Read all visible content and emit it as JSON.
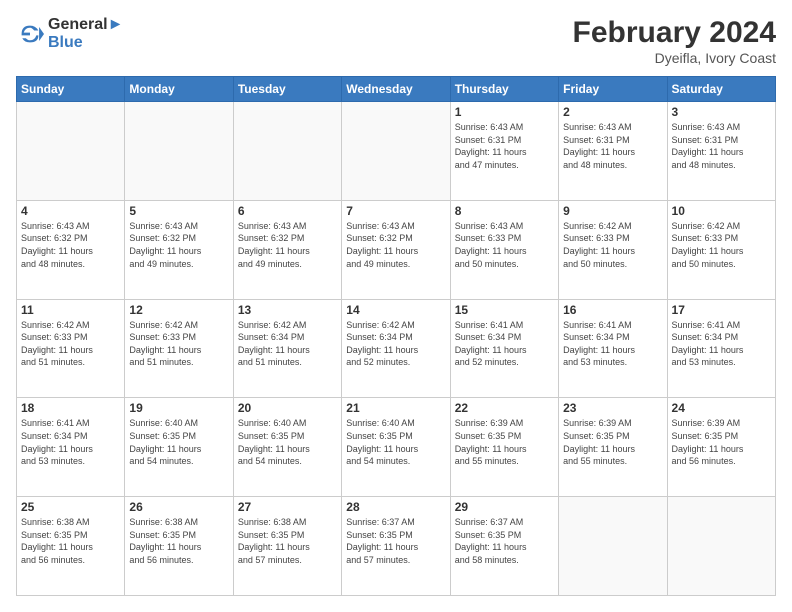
{
  "header": {
    "logo_line1": "General",
    "logo_line2": "Blue",
    "month_title": "February 2024",
    "subtitle": "Dyeifla, Ivory Coast"
  },
  "weekdays": [
    "Sunday",
    "Monday",
    "Tuesday",
    "Wednesday",
    "Thursday",
    "Friday",
    "Saturday"
  ],
  "weeks": [
    [
      {
        "num": "",
        "info": ""
      },
      {
        "num": "",
        "info": ""
      },
      {
        "num": "",
        "info": ""
      },
      {
        "num": "",
        "info": ""
      },
      {
        "num": "1",
        "info": "Sunrise: 6:43 AM\nSunset: 6:31 PM\nDaylight: 11 hours\nand 47 minutes."
      },
      {
        "num": "2",
        "info": "Sunrise: 6:43 AM\nSunset: 6:31 PM\nDaylight: 11 hours\nand 48 minutes."
      },
      {
        "num": "3",
        "info": "Sunrise: 6:43 AM\nSunset: 6:31 PM\nDaylight: 11 hours\nand 48 minutes."
      }
    ],
    [
      {
        "num": "4",
        "info": "Sunrise: 6:43 AM\nSunset: 6:32 PM\nDaylight: 11 hours\nand 48 minutes."
      },
      {
        "num": "5",
        "info": "Sunrise: 6:43 AM\nSunset: 6:32 PM\nDaylight: 11 hours\nand 49 minutes."
      },
      {
        "num": "6",
        "info": "Sunrise: 6:43 AM\nSunset: 6:32 PM\nDaylight: 11 hours\nand 49 minutes."
      },
      {
        "num": "7",
        "info": "Sunrise: 6:43 AM\nSunset: 6:32 PM\nDaylight: 11 hours\nand 49 minutes."
      },
      {
        "num": "8",
        "info": "Sunrise: 6:43 AM\nSunset: 6:33 PM\nDaylight: 11 hours\nand 50 minutes."
      },
      {
        "num": "9",
        "info": "Sunrise: 6:42 AM\nSunset: 6:33 PM\nDaylight: 11 hours\nand 50 minutes."
      },
      {
        "num": "10",
        "info": "Sunrise: 6:42 AM\nSunset: 6:33 PM\nDaylight: 11 hours\nand 50 minutes."
      }
    ],
    [
      {
        "num": "11",
        "info": "Sunrise: 6:42 AM\nSunset: 6:33 PM\nDaylight: 11 hours\nand 51 minutes."
      },
      {
        "num": "12",
        "info": "Sunrise: 6:42 AM\nSunset: 6:33 PM\nDaylight: 11 hours\nand 51 minutes."
      },
      {
        "num": "13",
        "info": "Sunrise: 6:42 AM\nSunset: 6:34 PM\nDaylight: 11 hours\nand 51 minutes."
      },
      {
        "num": "14",
        "info": "Sunrise: 6:42 AM\nSunset: 6:34 PM\nDaylight: 11 hours\nand 52 minutes."
      },
      {
        "num": "15",
        "info": "Sunrise: 6:41 AM\nSunset: 6:34 PM\nDaylight: 11 hours\nand 52 minutes."
      },
      {
        "num": "16",
        "info": "Sunrise: 6:41 AM\nSunset: 6:34 PM\nDaylight: 11 hours\nand 53 minutes."
      },
      {
        "num": "17",
        "info": "Sunrise: 6:41 AM\nSunset: 6:34 PM\nDaylight: 11 hours\nand 53 minutes."
      }
    ],
    [
      {
        "num": "18",
        "info": "Sunrise: 6:41 AM\nSunset: 6:34 PM\nDaylight: 11 hours\nand 53 minutes."
      },
      {
        "num": "19",
        "info": "Sunrise: 6:40 AM\nSunset: 6:35 PM\nDaylight: 11 hours\nand 54 minutes."
      },
      {
        "num": "20",
        "info": "Sunrise: 6:40 AM\nSunset: 6:35 PM\nDaylight: 11 hours\nand 54 minutes."
      },
      {
        "num": "21",
        "info": "Sunrise: 6:40 AM\nSunset: 6:35 PM\nDaylight: 11 hours\nand 54 minutes."
      },
      {
        "num": "22",
        "info": "Sunrise: 6:39 AM\nSunset: 6:35 PM\nDaylight: 11 hours\nand 55 minutes."
      },
      {
        "num": "23",
        "info": "Sunrise: 6:39 AM\nSunset: 6:35 PM\nDaylight: 11 hours\nand 55 minutes."
      },
      {
        "num": "24",
        "info": "Sunrise: 6:39 AM\nSunset: 6:35 PM\nDaylight: 11 hours\nand 56 minutes."
      }
    ],
    [
      {
        "num": "25",
        "info": "Sunrise: 6:38 AM\nSunset: 6:35 PM\nDaylight: 11 hours\nand 56 minutes."
      },
      {
        "num": "26",
        "info": "Sunrise: 6:38 AM\nSunset: 6:35 PM\nDaylight: 11 hours\nand 56 minutes."
      },
      {
        "num": "27",
        "info": "Sunrise: 6:38 AM\nSunset: 6:35 PM\nDaylight: 11 hours\nand 57 minutes."
      },
      {
        "num": "28",
        "info": "Sunrise: 6:37 AM\nSunset: 6:35 PM\nDaylight: 11 hours\nand 57 minutes."
      },
      {
        "num": "29",
        "info": "Sunrise: 6:37 AM\nSunset: 6:35 PM\nDaylight: 11 hours\nand 58 minutes."
      },
      {
        "num": "",
        "info": ""
      },
      {
        "num": "",
        "info": ""
      }
    ]
  ]
}
